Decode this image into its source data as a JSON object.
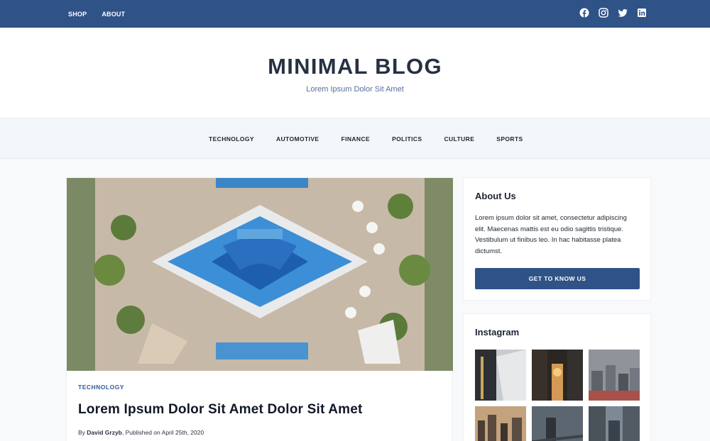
{
  "topbar": {
    "links": [
      "SHOP",
      "ABOUT"
    ],
    "accent": "#2f5287"
  },
  "social": [
    "facebook-icon",
    "instagram-icon",
    "twitter-icon",
    "linkedin-icon"
  ],
  "blog": {
    "title": "MINIMAL BLOG",
    "subtitle": "Lorem Ipsum Dolor Sit Amet"
  },
  "categories": [
    "TECHNOLOGY",
    "AUTOMOTIVE",
    "FINANCE",
    "POLITICS",
    "CULTURE",
    "SPORTS"
  ],
  "post": {
    "category": "TECHNOLOGY",
    "title": "Lorem Ipsum Dolor Sit Amet Dolor Sit Amet",
    "by": "By ",
    "author": "David Grzyb",
    "published": ", Published on April 25th, 2020"
  },
  "about": {
    "title": "About Us",
    "text": "Lorem ipsum dolor sit amet, consectetur adipiscing elit. Maecenas mattis est eu odio sagittis tristique. Vestibulum ut finibus leo. In hac habitasse platea dictumst.",
    "button": "GET TO KNOW US"
  },
  "instagram": {
    "title": "Instagram"
  }
}
